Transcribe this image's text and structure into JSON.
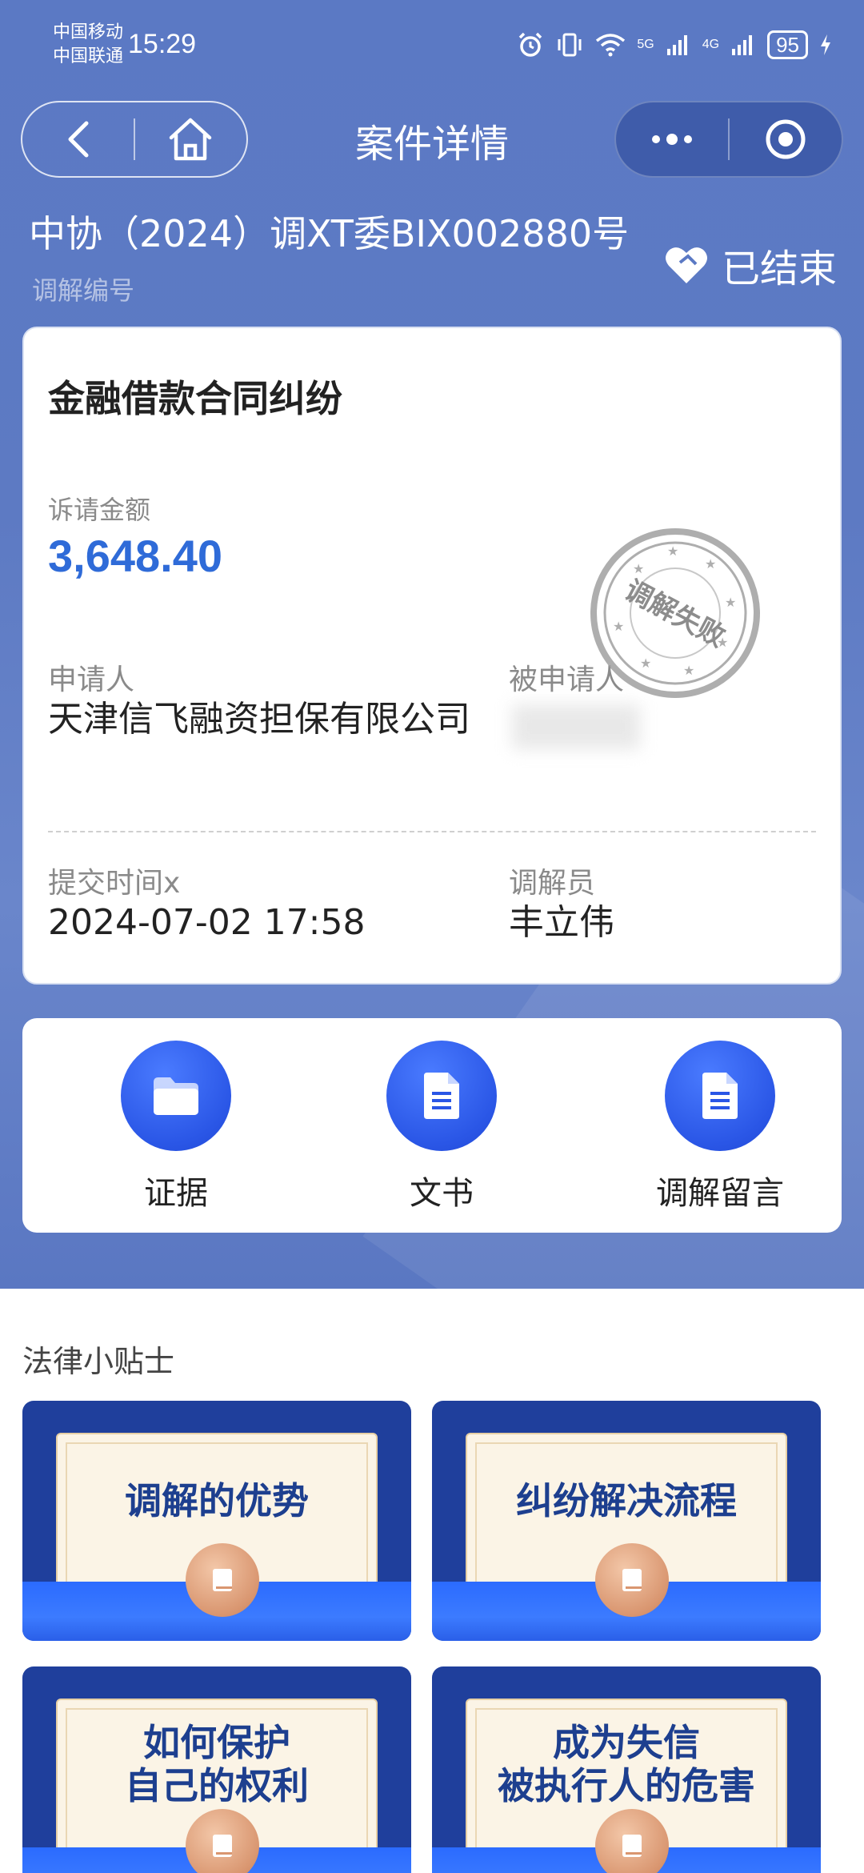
{
  "status_bar": {
    "carrier_1": "中国移动",
    "carrier_2": "中国联通",
    "time": "15:29",
    "net_5g": "5G",
    "net_4g": "4G",
    "battery": "95"
  },
  "nav": {
    "title": "案件详情"
  },
  "case": {
    "number": "中协（2024）调XT委BIX002880号",
    "number_label": "调解编号",
    "status": "已结束",
    "dispute_type": "金融借款合同纠纷",
    "amount_label": "诉请金额",
    "amount": "3,648.40",
    "applicant_label": "申请人",
    "applicant": "天津信飞融资担保有限公司",
    "respondent_label": "被申请人",
    "submit_time_label": "提交时间x",
    "submit_time": "2024-07-02 17:58",
    "mediator_label": "调解员",
    "mediator": "丰立伟",
    "stamp_text": "调解失败"
  },
  "actions": [
    {
      "label": "证据",
      "icon": "folder-icon"
    },
    {
      "label": "文书",
      "icon": "document-icon"
    },
    {
      "label": "调解留言",
      "icon": "document-icon"
    }
  ],
  "tips": {
    "title": "法律小贴士",
    "items": [
      {
        "line1": "调解的优势",
        "line2": ""
      },
      {
        "line1": "纠纷解决流程",
        "line2": ""
      },
      {
        "line1": "如何保护",
        "line2": "自己的权利"
      },
      {
        "line1": "成为失信",
        "line2": "被执行人的危害"
      }
    ]
  },
  "colors": {
    "header_bg": "#5b79c4",
    "accent_blue": "#2f6bd8",
    "action_circle": "#2a56e6",
    "tip_bg": "#1f3f9c"
  }
}
